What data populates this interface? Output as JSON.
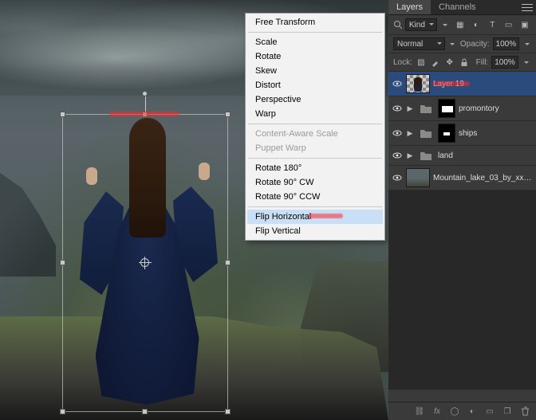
{
  "context_menu": {
    "free_transform": "Free Transform",
    "scale": "Scale",
    "rotate": "Rotate",
    "skew": "Skew",
    "distort": "Distort",
    "perspective": "Perspective",
    "warp": "Warp",
    "content_aware_scale": "Content-Aware Scale",
    "puppet_warp": "Puppet Warp",
    "rotate_180": "Rotate 180°",
    "rotate_90_cw": "Rotate 90° CW",
    "rotate_90_ccw": "Rotate 90° CCW",
    "flip_horizontal": "Flip Horizontal",
    "flip_vertical": "Flip Vertical"
  },
  "panels": {
    "tabs": {
      "layers": "Layers",
      "channels": "Channels"
    },
    "filter_kind_label": "Kind",
    "blend_mode": "Normal",
    "opacity_label": "Opacity:",
    "opacity_value": "100%",
    "lock_label": "Lock:",
    "fill_label": "Fill:",
    "fill_value": "100%",
    "layers_list": [
      {
        "name": "Layer 19"
      },
      {
        "name": "promontory"
      },
      {
        "name": "ships"
      },
      {
        "name": "land"
      },
      {
        "name": "Mountain_lake_03_by_xxM…"
      }
    ]
  }
}
